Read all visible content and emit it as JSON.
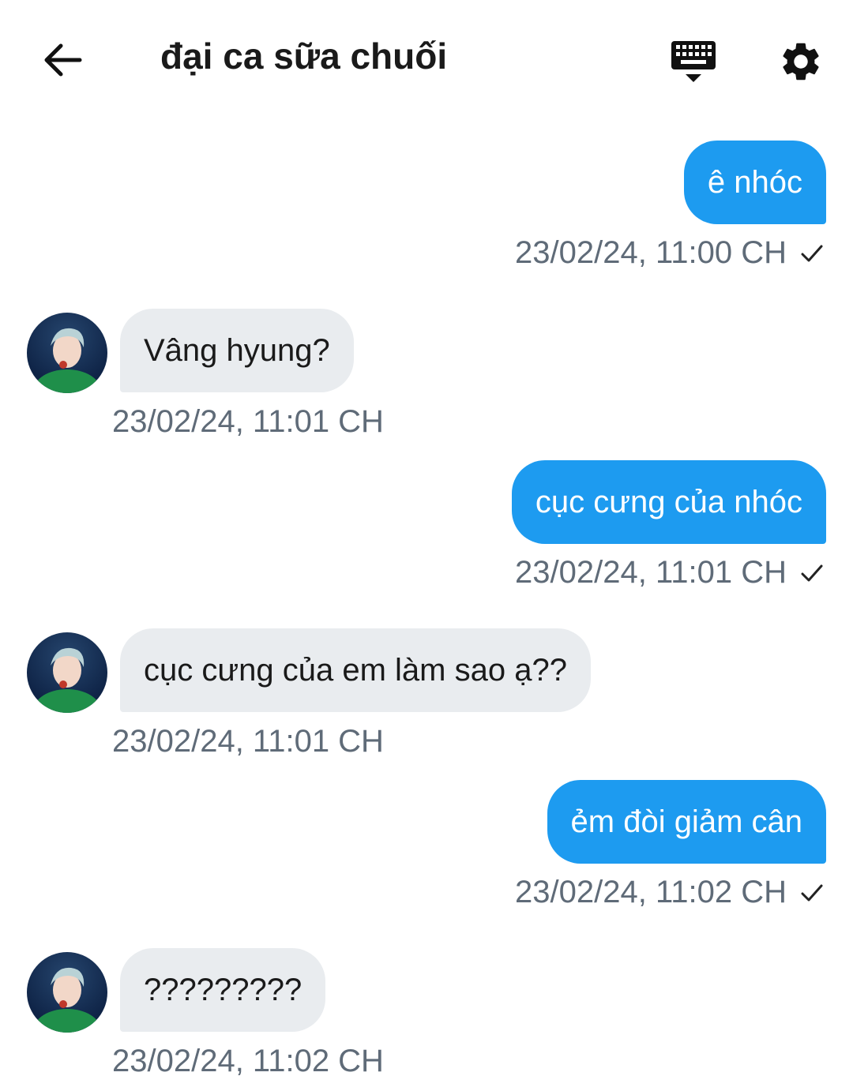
{
  "header": {
    "title": "đại ca sữa chuối",
    "back_icon": "arrow-left-icon",
    "keyboard_icon": "keyboard-hide-icon",
    "settings_icon": "gear-icon"
  },
  "colors": {
    "outgoing_bubble": "#1d9bf0",
    "incoming_bubble": "#e9ecef",
    "timestamp": "#5f6b78"
  },
  "messages": [
    {
      "direction": "out",
      "text": "ê nhóc",
      "time": "23/02/24, 11:00 CH",
      "status": "sent"
    },
    {
      "direction": "in",
      "text": "Vâng hyung?",
      "time": "23/02/24, 11:01 CH"
    },
    {
      "direction": "out",
      "text": "cục cưng của nhóc",
      "time": "23/02/24, 11:01 CH",
      "status": "sent"
    },
    {
      "direction": "in",
      "text": "cục cưng của em làm sao ạ??",
      "time": "23/02/24, 11:01 CH"
    },
    {
      "direction": "out",
      "text": "ẻm đòi giảm cân",
      "time": "23/02/24, 11:02 CH",
      "status": "sent"
    },
    {
      "direction": "in",
      "text": "?????????",
      "time": "23/02/24, 11:02 CH"
    }
  ]
}
